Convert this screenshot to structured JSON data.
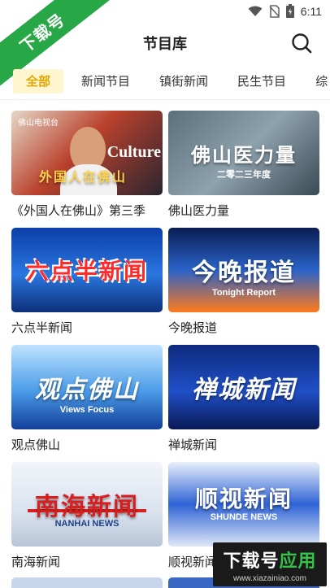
{
  "status": {
    "time": "6:11",
    "icons": [
      "wifi-icon",
      "no-sim-icon",
      "battery-icon"
    ]
  },
  "ribbon": {
    "text": "下载号"
  },
  "header": {
    "title": "节目库",
    "search_icon": "search-icon"
  },
  "tabs": [
    {
      "label": "全部",
      "active": true
    },
    {
      "label": "新闻节目",
      "active": false
    },
    {
      "label": "镇街新闻",
      "active": false
    },
    {
      "label": "民生节目",
      "active": false
    },
    {
      "label": "综",
      "active": false
    }
  ],
  "programs": [
    {
      "title": "《外国人在佛山》第三季",
      "thumb_main": "外国人在佛山",
      "thumb_en": "Culture",
      "thumb_small": "佛山电视台"
    },
    {
      "title": "佛山医力量",
      "thumb_main": "佛山医力量",
      "thumb_sub": "二零二三年度"
    },
    {
      "title": "六点半新闻",
      "thumb_main": "六点半新闻"
    },
    {
      "title": "今晚报道",
      "thumb_main": "今晚报道",
      "thumb_sub": "Tonight Report"
    },
    {
      "title": "观点佛山",
      "thumb_main": "观点佛山",
      "thumb_sub": "Views Focus"
    },
    {
      "title": "禅城新闻",
      "thumb_main": "禅城新闻"
    },
    {
      "title": "南海新闻",
      "thumb_main": "南海新闻",
      "thumb_sub": "NANHAI NEWS"
    },
    {
      "title": "顺视新闻",
      "thumb_main": "顺视新闻",
      "thumb_sub": "SHUNDE NEWS"
    }
  ],
  "watermark": {
    "main_a": "下载号",
    "main_b": "应用",
    "url": "www.xiazainiao.com"
  },
  "colors": {
    "accent": "#e0a800",
    "tab_active_bg": "#fff6cf",
    "ribbon": "#27a745"
  }
}
